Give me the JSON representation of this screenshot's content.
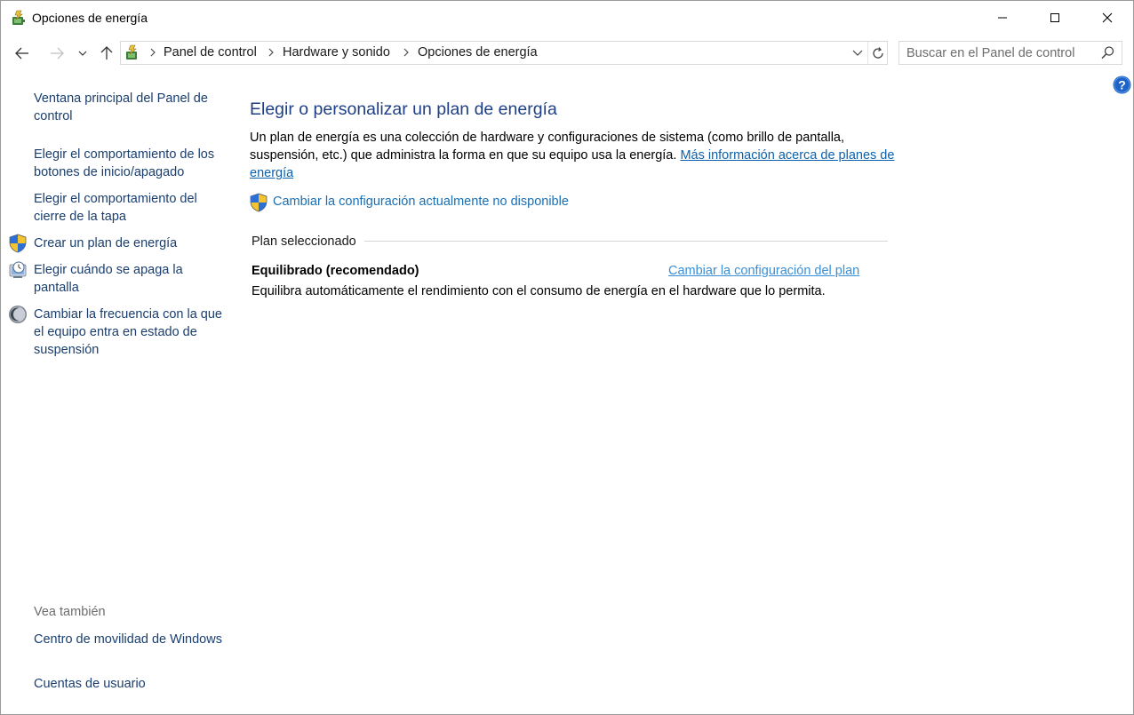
{
  "window": {
    "title": "Opciones de energía",
    "controls": {
      "minimize": "minimize-icon",
      "maximize": "maximize-icon",
      "close": "close-icon"
    }
  },
  "address_bar": {
    "breadcrumbs": [
      "Panel de control",
      "Hardware y sonido",
      "Opciones de energía"
    ]
  },
  "search": {
    "placeholder": "Buscar en el Panel de control"
  },
  "sidebar": {
    "home_link": "Ventana principal del Panel de control",
    "tasks": [
      {
        "label": "Elegir el comportamiento de los botones de inicio/apagado",
        "icon": null
      },
      {
        "label": "Elegir el comportamiento del cierre de la tapa",
        "icon": null
      },
      {
        "label": "Crear un plan de energía",
        "icon": "shield-icon"
      },
      {
        "label": "Elegir cuándo se apaga la pantalla",
        "icon": "monitor-clock-icon"
      },
      {
        "label": "Cambiar la frecuencia con la que el equipo entra en estado de suspensión",
        "icon": "moon-icon"
      }
    ],
    "see_also_title": "Vea también",
    "see_also": [
      "Centro de movilidad de Windows",
      "Cuentas de usuario"
    ]
  },
  "main": {
    "heading": "Elegir o personalizar un plan de energía",
    "description": "Un plan de energía es una colección de hardware y configuraciones de sistema (como brillo de pantalla, suspensión, etc.) que administra la forma en que su equipo usa la energía.",
    "more_info_link": "Más información acerca de planes de energía",
    "change_unavailable_link": "Cambiar la configuración actualmente no disponible",
    "selected_plan_label": "Plan seleccionado",
    "plan": {
      "name": "Equilibrado (recomendado)",
      "change_link": "Cambiar la configuración del plan",
      "description": "Equilibra automáticamente el rendimiento con el consumo de energía en el hardware que lo permita."
    }
  },
  "colors": {
    "heading": "#1e3f86",
    "link": "#1a6fb5",
    "sidebar_link": "#1a3e6e",
    "muted": "#6d6d6d"
  }
}
